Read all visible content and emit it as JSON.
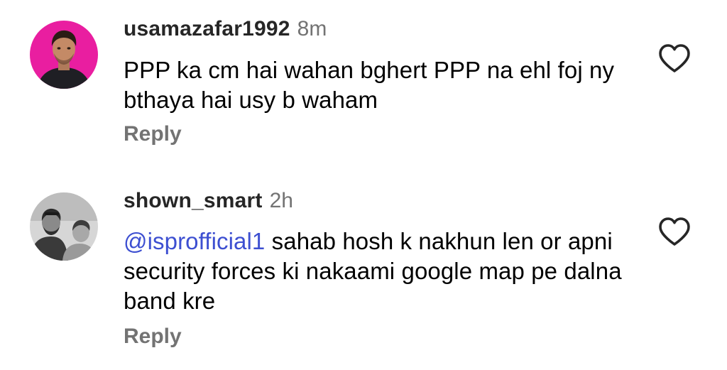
{
  "comments": [
    {
      "username": "usamazafar1992",
      "time": "8m",
      "text": "PPP ka cm hai wahan bghert PPP na ehl foj ny bthaya hai usy b waham",
      "mention": "",
      "reply_label": "Reply",
      "like_icon": "heart-outline-icon",
      "avatar_bg": "#e91ea0"
    },
    {
      "username": "shown_smart",
      "time": "2h",
      "text": " sahab hosh k nakhun len or apni security forces ki nakaami google map pe dalna band kre",
      "mention": "@isprofficial1",
      "reply_label": "Reply",
      "like_icon": "heart-outline-icon",
      "avatar_bg": "#d6d6d6"
    }
  ],
  "colors": {
    "username": "#262626",
    "meta": "#737373",
    "mention": "#3d4fd1",
    "icon": "#262626"
  }
}
